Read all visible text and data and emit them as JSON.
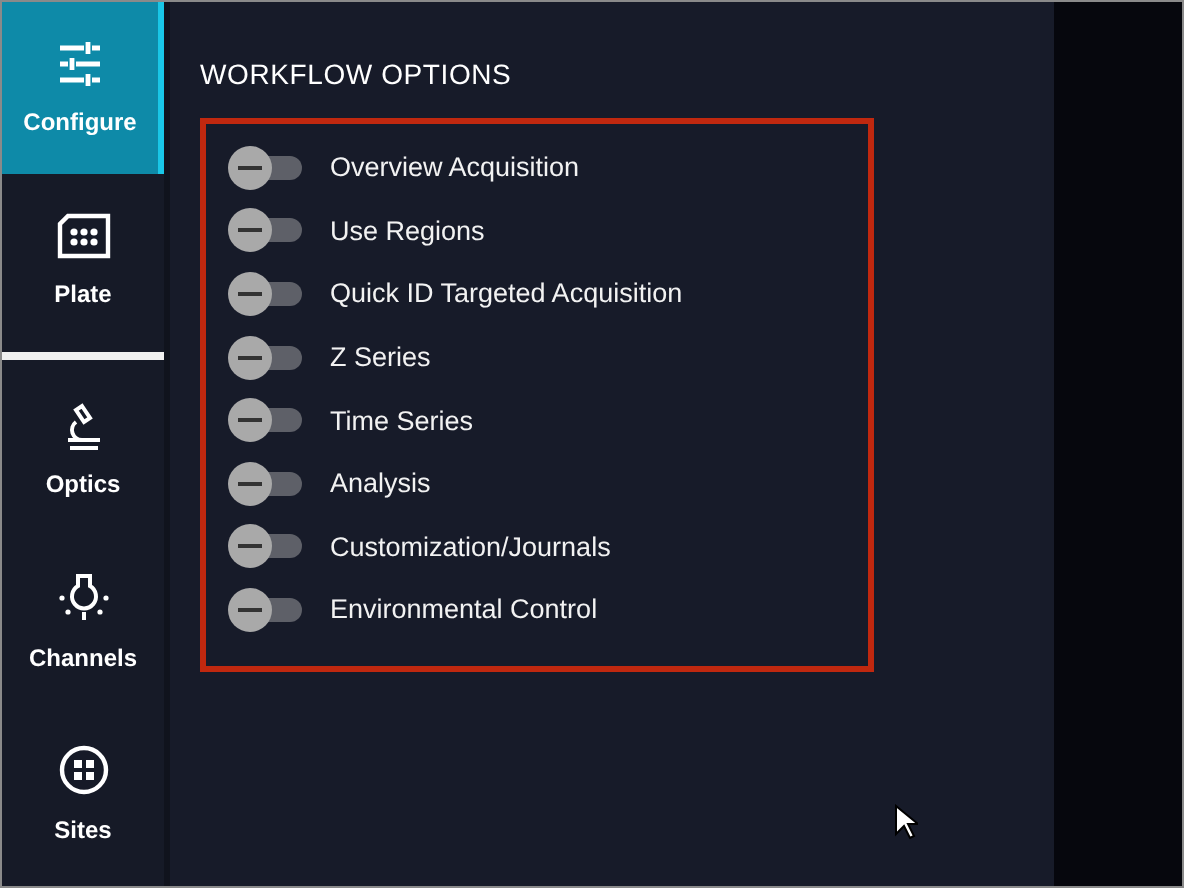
{
  "sidebar": {
    "items": [
      {
        "label": "Configure",
        "kind": "sliders",
        "selected": true
      },
      {
        "label": "Plate",
        "kind": "plate",
        "selected": false
      },
      {
        "label": "Optics",
        "kind": "microscope",
        "selected": false
      },
      {
        "label": "Channels",
        "kind": "bulb",
        "selected": false
      },
      {
        "label": "Sites",
        "kind": "sites",
        "selected": false
      }
    ]
  },
  "section_title": "WORKFLOW OPTIONS",
  "options": [
    {
      "label": "Overview Acquisition",
      "on": false
    },
    {
      "label": "Use Regions",
      "on": false
    },
    {
      "label": "Quick ID Targeted Acquisition",
      "on": false
    },
    {
      "label": "Z Series",
      "on": false
    },
    {
      "label": "Time Series",
      "on": false
    },
    {
      "label": "Analysis",
      "on": false
    },
    {
      "label": "Customization/Journals",
      "on": false
    },
    {
      "label": "Environmental Control",
      "on": false
    }
  ]
}
